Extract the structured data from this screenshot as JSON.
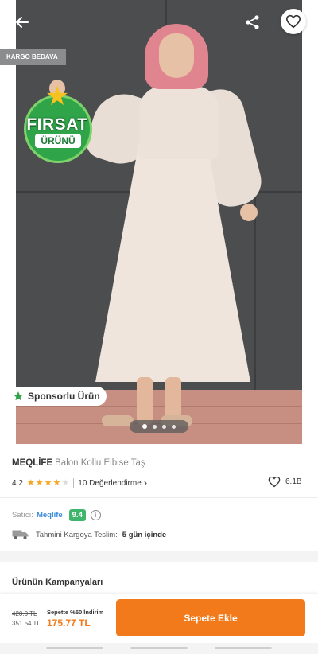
{
  "hero": {
    "kargo_tag": "KARGO BEDAVA",
    "badge": {
      "title": "FIRSAT",
      "ribbon": "ÜRÜNÜ"
    },
    "sponsored_label": "Sponsorlu Ürün",
    "image_count": 4,
    "active_image_index": 1
  },
  "product": {
    "brand": "MEQLİFE",
    "name": "Balon Kollu Elbise Taş",
    "rating": "4.2",
    "rating_value": 4.2,
    "rating_stars_filled": 4,
    "rating_stars_total": 5,
    "reviews_label": "10 Değerlendirme",
    "likes": "6.1B"
  },
  "seller": {
    "label": "Satıcı:",
    "name": "Meqlife",
    "score": "9.4"
  },
  "shipping": {
    "label": "Tahmini Kargoya Teslim:",
    "value": "5 gün içinde"
  },
  "campaigns": {
    "title": "Ürünün Kampanyaları"
  },
  "footer": {
    "old_price": "420.0 TL",
    "basket_price": "351.54 TL",
    "promo_label": "Sepette %50 İndirim",
    "promo_price": "175.77 TL",
    "cta_label": "Sepete Ekle"
  },
  "colors": {
    "accent": "#f27a1a",
    "seller_score": "#3fb66b",
    "star": "#f5a623",
    "seller_link": "#3b8ad8"
  },
  "icons": [
    "back-arrow-icon",
    "share-icon",
    "heart-icon",
    "star-icon",
    "info-icon",
    "truck-icon",
    "chevron-right-icon"
  ]
}
